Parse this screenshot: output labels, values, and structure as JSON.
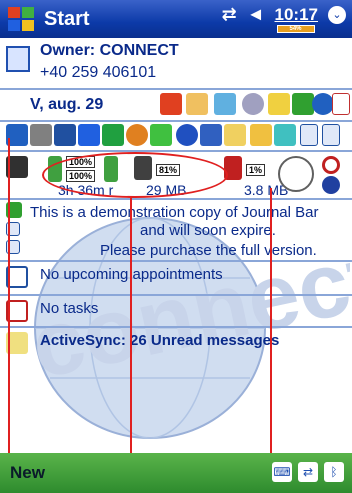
{
  "titlebar": {
    "title": "Start",
    "sync_icon": "⇄",
    "volume_icon": "◄",
    "clock": "10:17",
    "battery_text": "54%",
    "menu_chevron": "⌄"
  },
  "owner": {
    "name": "Owner: CONNECT",
    "phone": "+40 259 406101"
  },
  "date": "V, aug. 29",
  "battery": {
    "main_pct": "100%",
    "backup_pct": "100%",
    "time_left": "3h 36m r",
    "memory_pct": "81%",
    "memory": "29 MB",
    "storage_pct": "1%",
    "storage": "3.8 MB"
  },
  "demo_notice": {
    "line1": "This is a demonstration copy of Journal Bar",
    "line2": "and will soon expire.",
    "line3": "Please purchase the full version."
  },
  "appointments": "No upcoming appointments",
  "tasks": "No tasks",
  "activesync": "ActiveSync: 26 Unread messages",
  "watermark_text": "connect",
  "bottombar": {
    "new_label": "New"
  },
  "colors": {
    "titlebar": "#0c3aa8",
    "bottombar": "#3a9a3a",
    "text": "#0a2a8a",
    "callout": "#e02020"
  }
}
